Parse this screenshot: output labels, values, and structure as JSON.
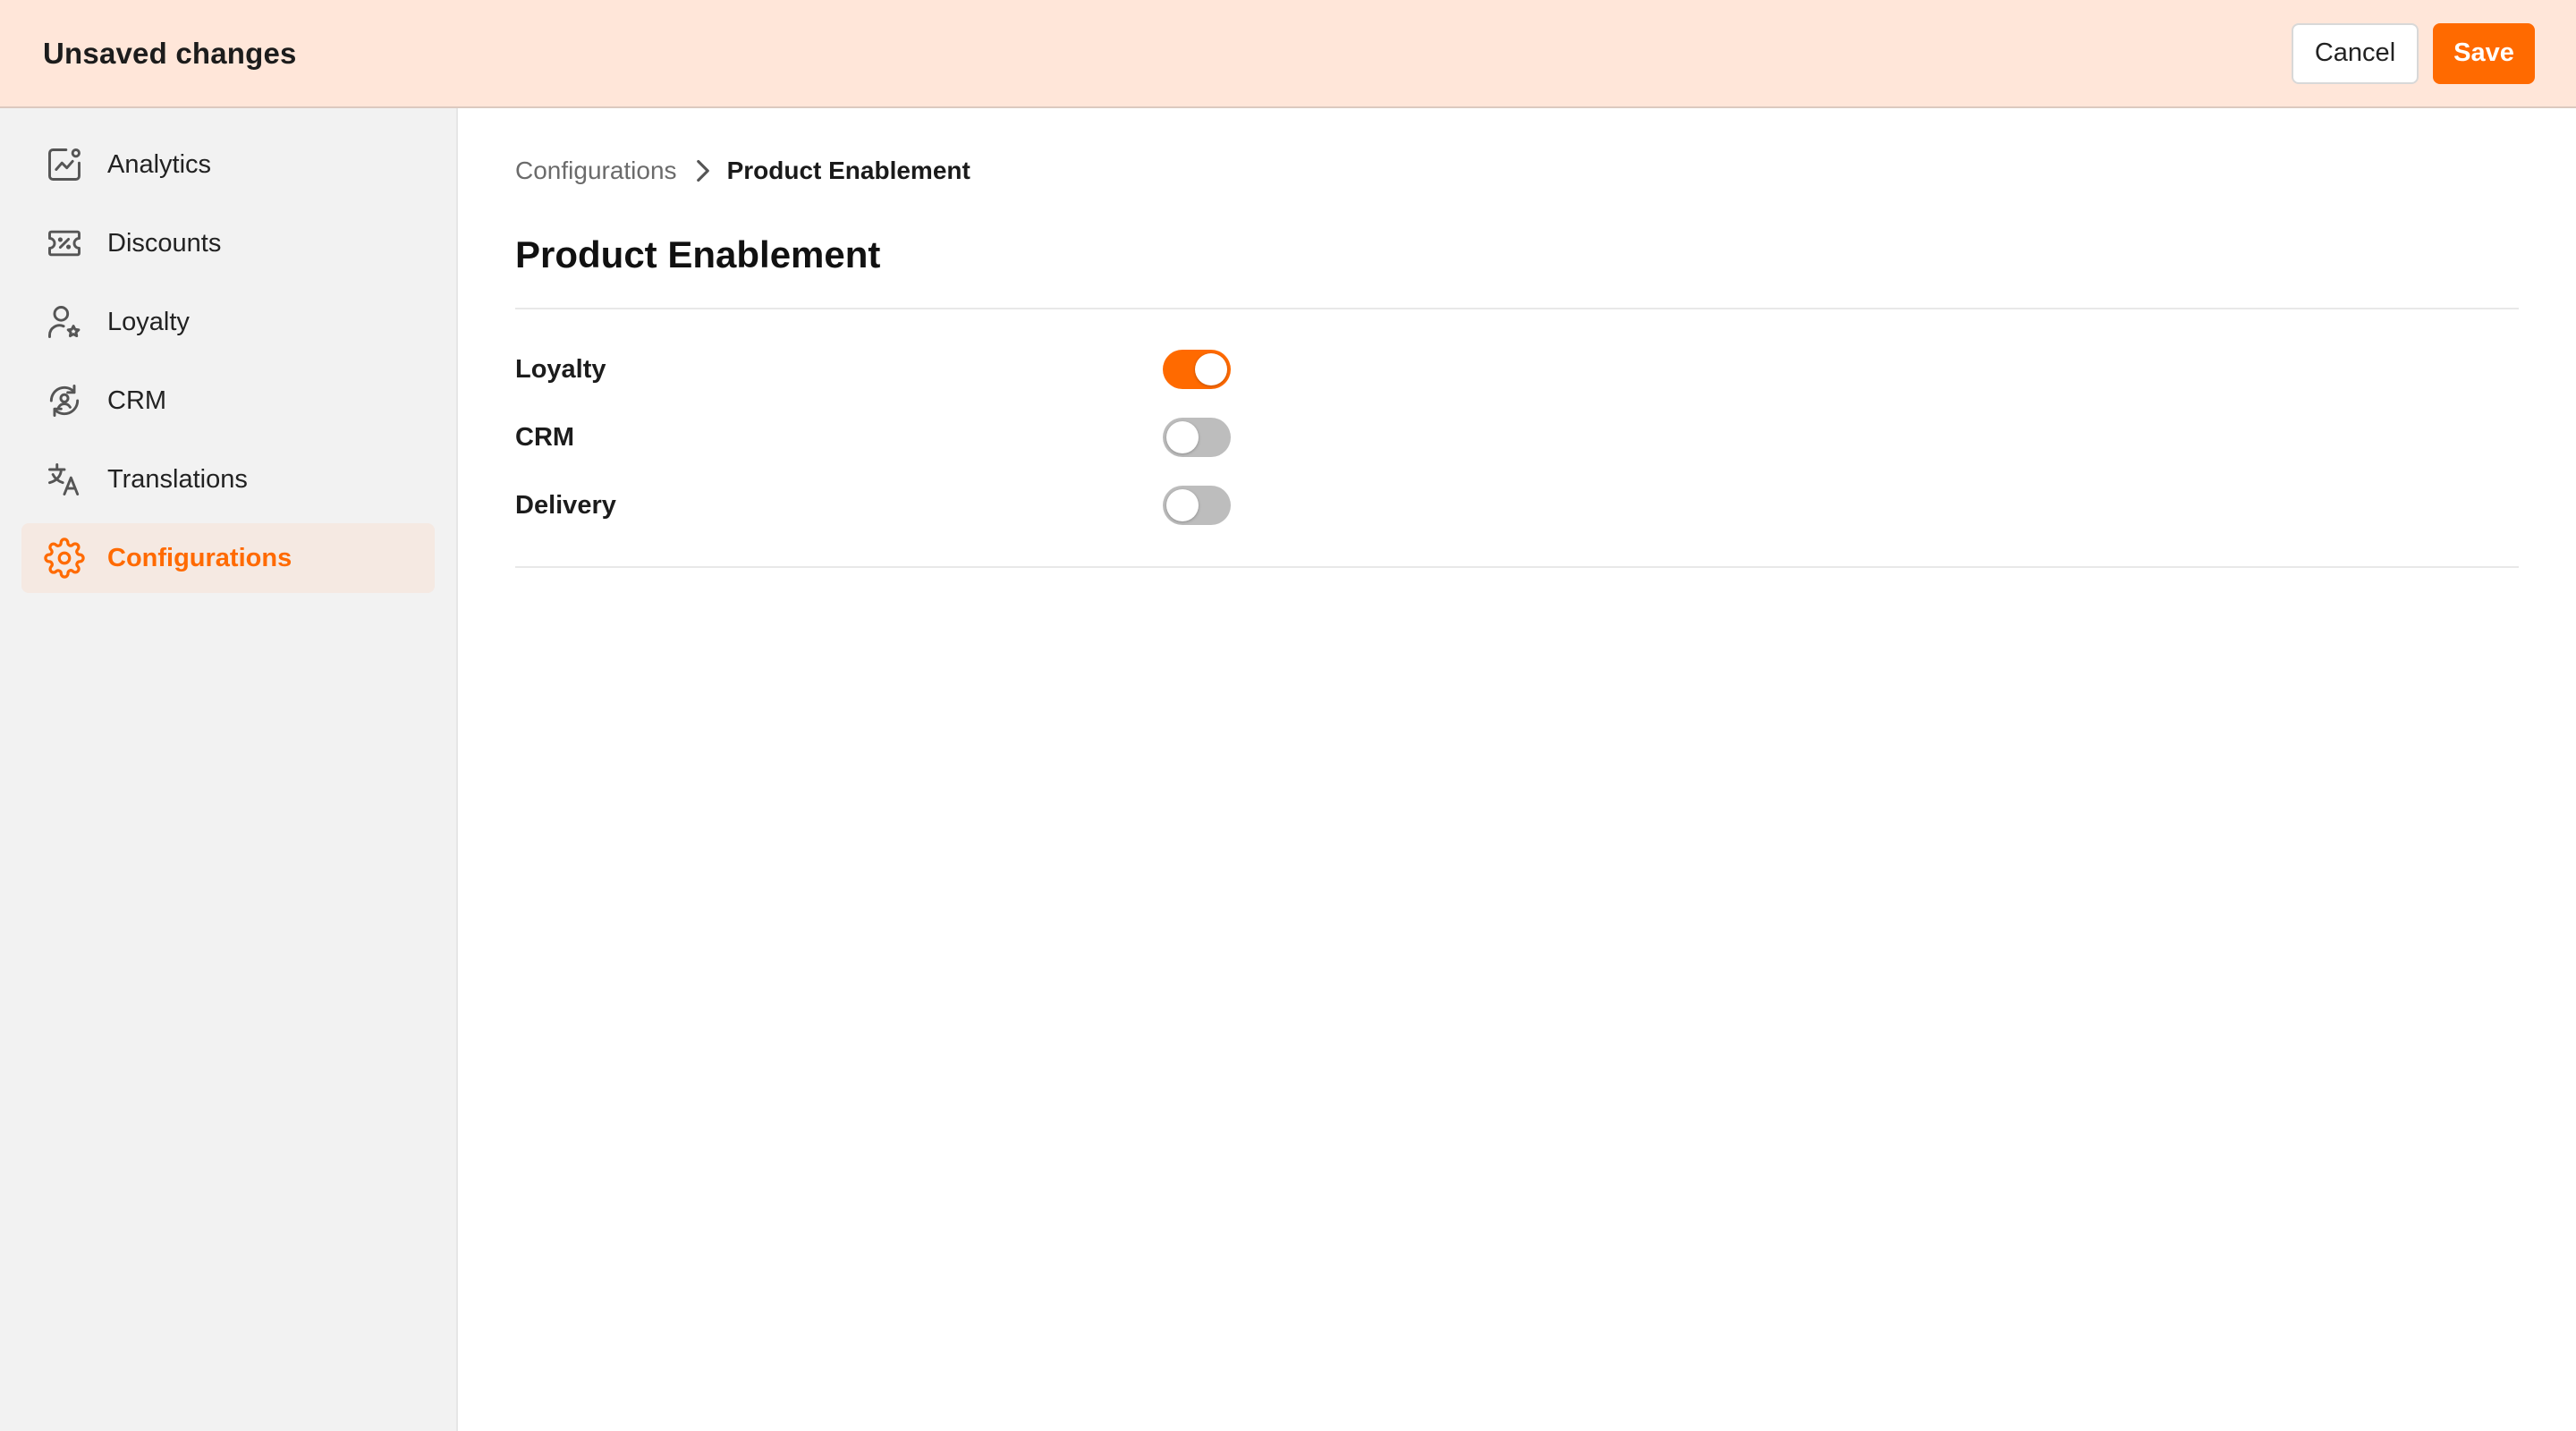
{
  "header": {
    "title": "Unsaved changes",
    "cancel_label": "Cancel",
    "save_label": "Save",
    "background": "#ffe6d9",
    "accent": "#ff6a00"
  },
  "sidebar": {
    "items": [
      {
        "label": "Analytics",
        "icon": "analytics-chart-icon",
        "active": false
      },
      {
        "label": "Discounts",
        "icon": "discount-ticket-icon",
        "active": false
      },
      {
        "label": "Loyalty",
        "icon": "user-star-icon",
        "active": false
      },
      {
        "label": "CRM",
        "icon": "user-sync-icon",
        "active": false
      },
      {
        "label": "Translations",
        "icon": "translate-icon",
        "active": false
      },
      {
        "label": "Configurations",
        "icon": "gear-icon",
        "active": true
      }
    ]
  },
  "breadcrumb": {
    "parent": "Configurations",
    "current": "Product Enablement",
    "separator_icon": "chevron-right-icon"
  },
  "main": {
    "title": "Product Enablement",
    "settings": [
      {
        "label": "Loyalty",
        "enabled": true
      },
      {
        "label": "CRM",
        "enabled": false
      },
      {
        "label": "Delivery",
        "enabled": false
      }
    ]
  }
}
